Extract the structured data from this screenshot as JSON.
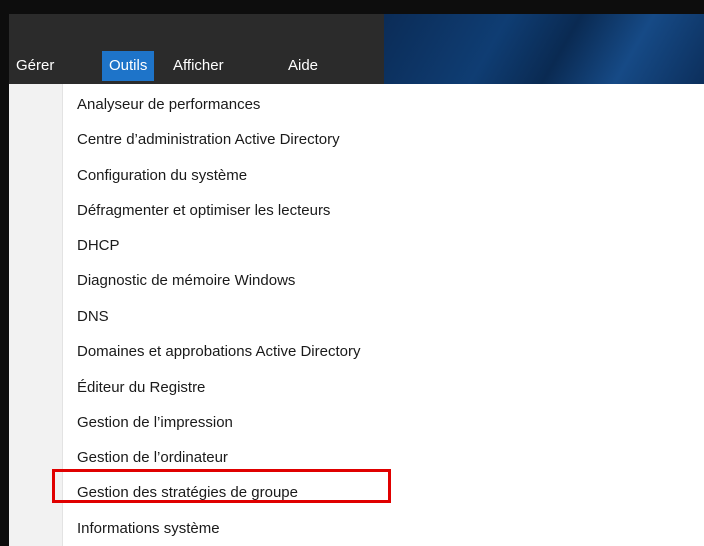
{
  "menubar": {
    "items": [
      {
        "label": "Gérer",
        "active": false
      },
      {
        "label": "Outils",
        "active": true
      },
      {
        "label": "Afficher",
        "active": false
      },
      {
        "label": "Aide",
        "active": false
      }
    ],
    "active_color": "#1e74c9",
    "background_color": "#2b2b2b"
  },
  "tools_menu": {
    "items": [
      {
        "label": "Analyseur de performances"
      },
      {
        "label": "Centre d’administration Active Directory"
      },
      {
        "label": "Configuration du système"
      },
      {
        "label": "Défragmenter et optimiser les lecteurs"
      },
      {
        "label": "DHCP"
      },
      {
        "label": "Diagnostic de mémoire Windows"
      },
      {
        "label": "DNS"
      },
      {
        "label": "Domaines et approbations Active Directory"
      },
      {
        "label": "Éditeur du Registre"
      },
      {
        "label": "Gestion de l’impression"
      },
      {
        "label": "Gestion de l’ordinateur"
      },
      {
        "label": "Gestion des stratégies de groupe",
        "highlighted": true
      },
      {
        "label": "Informations système"
      }
    ],
    "highlight_color": "#e00000"
  }
}
